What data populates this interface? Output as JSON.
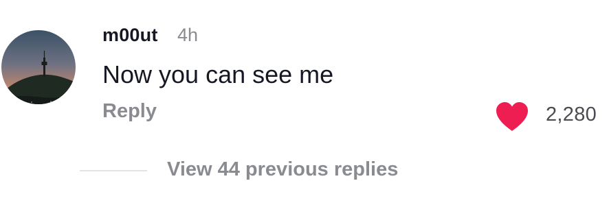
{
  "comment": {
    "username": "m00ut",
    "timestamp": "4h",
    "text": "Now you can see me",
    "reply_label": "Reply",
    "like_count": "2,280",
    "liked": true,
    "like_color": "#ee1d52",
    "avatar_icon": "avatar-city-tower-sunset"
  },
  "replies": {
    "view_label": "View 44 previous replies"
  }
}
